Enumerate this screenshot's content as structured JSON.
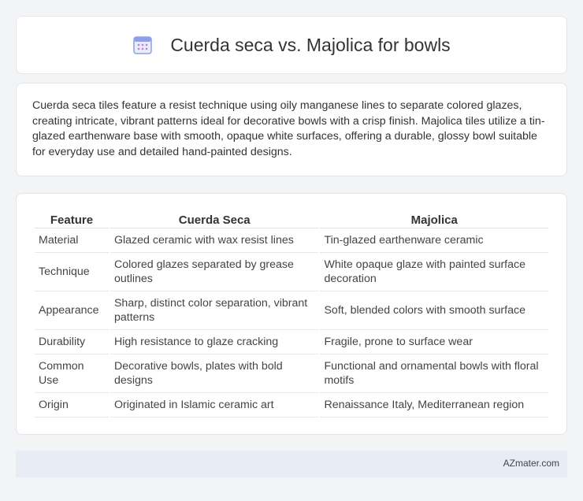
{
  "header": {
    "title": "Cuerda seca vs. Majolica for bowls",
    "icon": "calendar-icon"
  },
  "intro": {
    "text": "Cuerda seca tiles feature a resist technique using oily manganese lines to separate colored glazes, creating intricate, vibrant patterns ideal for decorative bowls with a crisp finish. Majolica tiles utilize a tin-glazed earthenware base with smooth, opaque white surfaces, offering a durable, glossy bowl suitable for everyday use and detailed hand-painted designs."
  },
  "table": {
    "headers": [
      "Feature",
      "Cuerda Seca",
      "Majolica"
    ],
    "rows": [
      [
        "Material",
        "Glazed ceramic with wax resist lines",
        "Tin-glazed earthenware ceramic"
      ],
      [
        "Technique",
        "Colored glazes separated by grease outlines",
        "White opaque glaze with painted surface decoration"
      ],
      [
        "Appearance",
        "Sharp, distinct color separation, vibrant patterns",
        "Soft, blended colors with smooth surface"
      ],
      [
        "Durability",
        "High resistance to glaze cracking",
        "Fragile, prone to surface wear"
      ],
      [
        "Common Use",
        "Decorative bowls, plates with bold designs",
        "Functional and ornamental bowls with floral motifs"
      ],
      [
        "Origin",
        "Originated in Islamic ceramic art",
        "Renaissance Italy, Mediterranean region"
      ]
    ]
  },
  "footer": {
    "text": "AZmater.com"
  },
  "colors": {
    "background": "#f3f4f6",
    "card": "#ffffff",
    "footer": "#e8ecf5",
    "icon_accent": "#7b8cde"
  }
}
